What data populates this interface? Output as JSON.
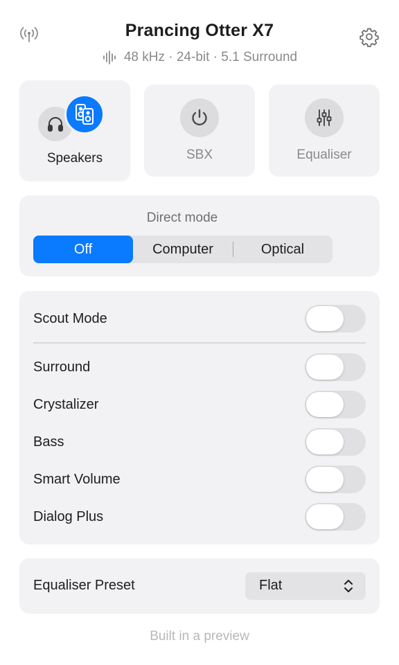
{
  "header": {
    "title": "Prancing Otter X7",
    "format": "48 kHz · 24-bit · 5.1 Surround",
    "left_icon": "antenna-icon",
    "right_icon": "gear-icon"
  },
  "outputs": {
    "speakers": {
      "label": "Speakers",
      "icon": "speaker-icon",
      "secondary_icon": "headphones-icon",
      "selected": true
    },
    "sbx": {
      "label": "SBX",
      "icon": "power-icon",
      "selected": false
    },
    "equaliser": {
      "label": "Equaliser",
      "icon": "sliders-icon",
      "selected": false
    }
  },
  "direct_mode": {
    "title": "Direct mode",
    "options": [
      "Off",
      "Computer",
      "Optical"
    ],
    "selected": "Off"
  },
  "toggles": [
    {
      "label": "Scout Mode",
      "on": false
    },
    {
      "label": "Surround",
      "on": false
    },
    {
      "label": "Crystalizer",
      "on": false
    },
    {
      "label": "Bass",
      "on": false
    },
    {
      "label": "Smart Volume",
      "on": false
    },
    {
      "label": "Dialog Plus",
      "on": false
    }
  ],
  "preset": {
    "label": "Equaliser Preset",
    "value": "Flat"
  },
  "footer": "Built in a preview",
  "colors": {
    "accent": "#0a7aff",
    "panel": "#f2f2f4",
    "muted_text": "#8a8a8e"
  }
}
